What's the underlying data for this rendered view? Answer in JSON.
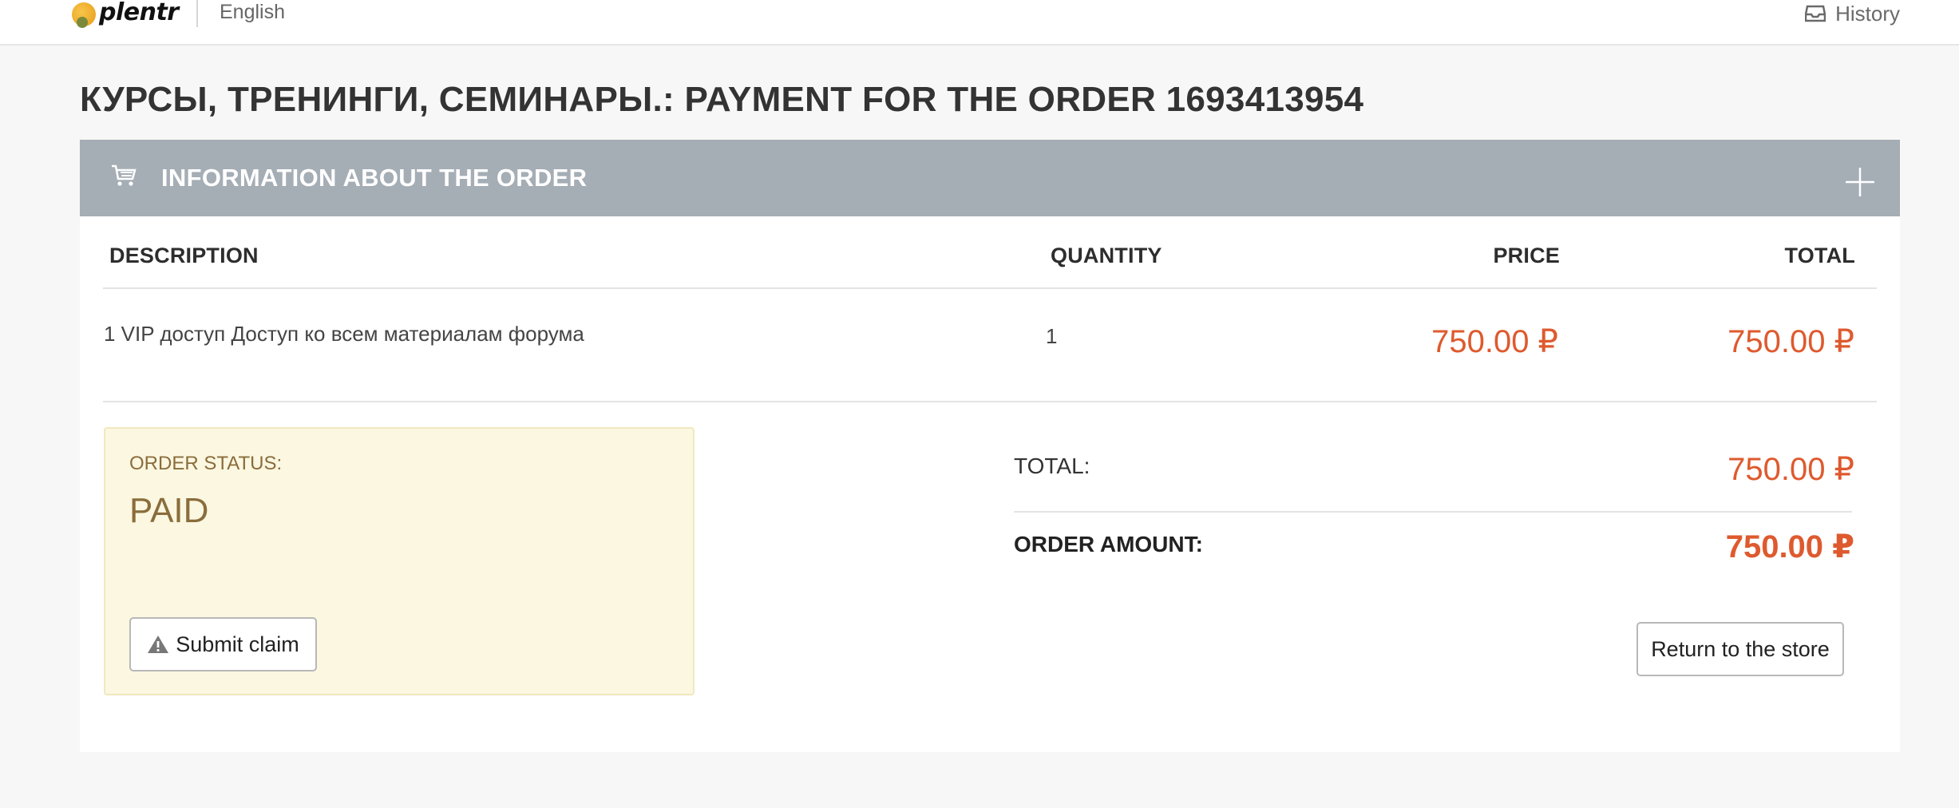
{
  "header": {
    "logo_text": "plentr",
    "language": "English",
    "history_label": "History"
  },
  "page": {
    "title": "КУРСЫ, ТРЕНИНГИ, СЕМИНАРЫ.: PAYMENT FOR THE ORDER 1693413954"
  },
  "order_card": {
    "title": "INFORMATION ABOUT THE ORDER",
    "columns": {
      "description": "DESCRIPTION",
      "quantity": "QUANTITY",
      "price": "PRICE",
      "total": "TOTAL"
    },
    "items": [
      {
        "description": "1 VIP доступ Доступ ко всем материалам форума",
        "quantity": "1",
        "price": "750.00 ₽",
        "total": "750.00 ₽"
      }
    ]
  },
  "status": {
    "label": "ORDER STATUS:",
    "value": "PAID",
    "claim_button": "Submit claim"
  },
  "summary": {
    "total_label": "TOTAL:",
    "total_value": "750.00 ₽",
    "amount_label": "ORDER AMOUNT:",
    "amount_value": "750.00 ₽",
    "return_button": "Return to the store"
  },
  "colors": {
    "accent_price": "#de5a2e",
    "header_bar": "#a5adb5",
    "status_background": "#fbf7e1",
    "status_text": "#8a6d3b"
  },
  "icons": {
    "history": "inbox-icon",
    "cart": "cart-icon",
    "expand": "plus-icon",
    "claim": "warning-icon"
  }
}
